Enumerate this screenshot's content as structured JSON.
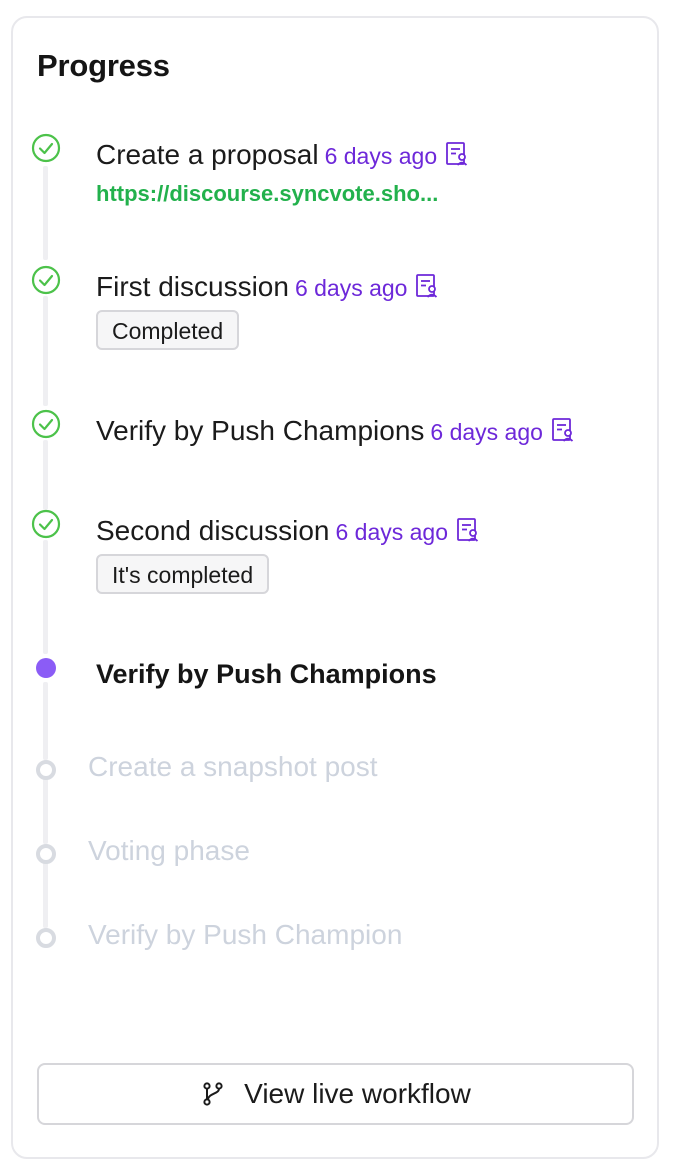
{
  "panel": {
    "title": "Progress"
  },
  "steps": [
    {
      "title": "Create a proposal",
      "time": "6 days ago",
      "link": "https://discourse.syncvote.sho...",
      "status": "done"
    },
    {
      "title": "First discussion",
      "time": "6 days ago",
      "note": "Completed",
      "status": "done"
    },
    {
      "title": "Verify by Push Champions",
      "time": "6 days ago",
      "status": "done"
    },
    {
      "title": "Second discussion",
      "time": "6 days ago",
      "note": "It's completed",
      "status": "done"
    },
    {
      "title": "Verify by Push Champions",
      "status": "current"
    },
    {
      "title": "Create a snapshot post",
      "status": "pending"
    },
    {
      "title": "Voting phase",
      "status": "pending"
    },
    {
      "title": "Verify by Push Champion",
      "status": "pending"
    }
  ],
  "footer": {
    "button_label": "View live workflow",
    "button_icon": "git-branch-icon"
  },
  "icons": {
    "done": "check-circle-icon",
    "time_attachment": "document-icon"
  },
  "colors": {
    "done": "#4cc24a",
    "current": "#8b5cf6",
    "time": "#6d28d9",
    "link": "#22b14c",
    "pending": "#cdd3dd"
  }
}
